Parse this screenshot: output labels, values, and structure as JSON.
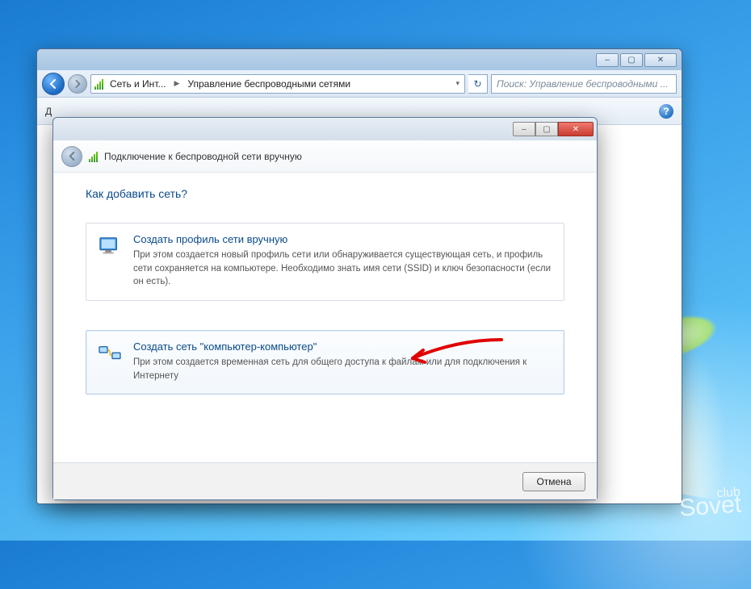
{
  "outerWindow": {
    "breadcrumbs": {
      "part1": "Сеть и Инт...",
      "part2": "Управление беспроводными сетями"
    },
    "search_placeholder": "Поиск: Управление беспроводными ...",
    "toolbar_left": "Д",
    "window_controls": {
      "min": "–",
      "max": "▢",
      "close": "✕"
    }
  },
  "wizard": {
    "window_controls": {
      "min": "–",
      "max": "▢",
      "close": "✕"
    },
    "title": "Подключение к беспроводной сети вручную",
    "heading": "Как добавить сеть?",
    "option1": {
      "title": "Создать профиль сети вручную",
      "desc": "При этом создается новый профиль сети или обнаруживается существующая сеть, и профиль сети сохраняется на компьютере. Необходимо знать имя сети (SSID) и ключ безопасности (если он есть)."
    },
    "option2": {
      "title": "Создать сеть \"компьютер-компьютер\"",
      "desc": "При этом создается временная сеть для общего доступа к файлам или для подключения к Интернету"
    },
    "cancel": "Отмена"
  },
  "watermark": {
    "small": "club",
    "big": "Sovet"
  }
}
